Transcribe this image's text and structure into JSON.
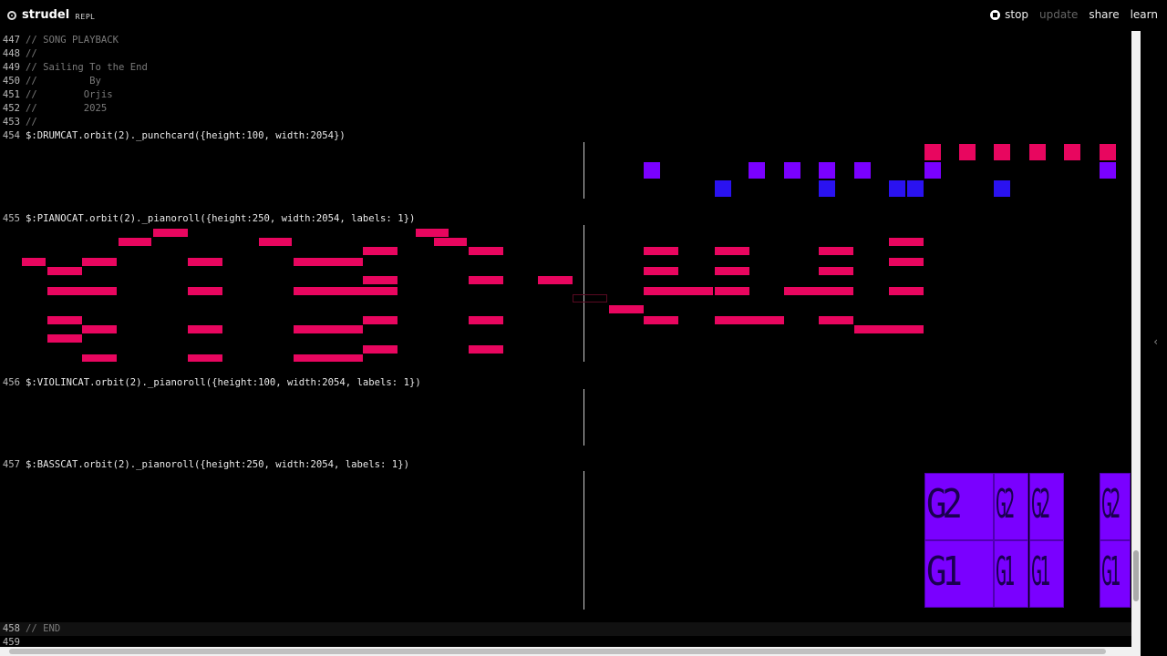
{
  "app": {
    "name": "strudel",
    "sub": "REPL"
  },
  "actions": {
    "stop": "stop",
    "update": "update",
    "share": "share",
    "learn": "learn"
  },
  "collapse_glyph": "‹",
  "code_lines": [
    {
      "n": "447",
      "text": "// SONG PLAYBACK"
    },
    {
      "n": "448",
      "text": "//"
    },
    {
      "n": "449",
      "text": "// Sailing To the End"
    },
    {
      "n": "450",
      "text": "//         By"
    },
    {
      "n": "451",
      "text": "//        Orjis"
    },
    {
      "n": "452",
      "text": "//        2025"
    },
    {
      "n": "453",
      "text": "//"
    },
    {
      "n": "454",
      "text": "$:DRUMCAT.orbit(2)._punchcard({height:100, width:2054})"
    },
    {
      "n": "455",
      "text": "$:PIANOCAT.orbit(2)._pianoroll({height:250, width:2054, labels: 1})"
    },
    {
      "n": "456",
      "text": "$:VIOLINCAT.orbit(2)._pianoroll({height:100, width:2054, labels: 1})"
    },
    {
      "n": "457",
      "text": "$:BASSCAT.orbit(2)._pianoroll({height:250, width:2054, labels: 1})"
    },
    {
      "n": "458",
      "text": "// END"
    },
    {
      "n": "459",
      "text": ""
    }
  ],
  "colors": {
    "pink": "#e8065f",
    "purple": "#7a00ff",
    "blue": "#2a12f0",
    "playhead": "#cccccc"
  },
  "bass_labels": {
    "upper": "G2",
    "lower": "G1"
  }
}
